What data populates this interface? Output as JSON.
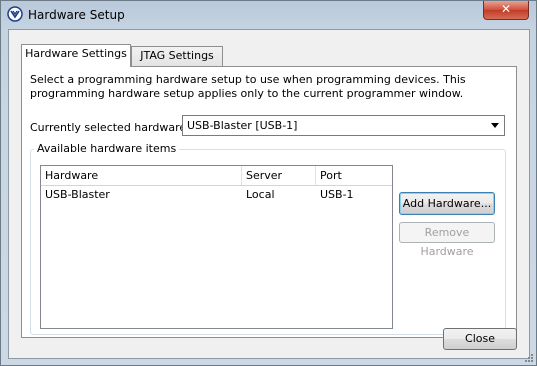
{
  "window": {
    "title": "Hardware Setup",
    "close_glyph": "✕"
  },
  "tabs": [
    {
      "label": "Hardware Settings",
      "selected": true
    },
    {
      "label": "JTAG Settings",
      "selected": false
    }
  ],
  "description": "Select a programming hardware setup to use when programming devices. This programming hardware setup applies only to the current programmer window.",
  "current_hardware": {
    "label": "Currently selected hardware:",
    "value": "USB-Blaster [USB-1]"
  },
  "available": {
    "group_label": "Available hardware items",
    "columns": [
      "Hardware",
      "Server",
      "Port"
    ],
    "rows": [
      {
        "hardware": "USB-Blaster",
        "server": "Local",
        "port": "USB-1"
      }
    ]
  },
  "buttons": {
    "add": "Add Hardware...",
    "remove": "Remove Hardware",
    "close": "Close"
  },
  "icons": {
    "app": "app-icon",
    "combo_arrow": "chevron-down-icon",
    "resize": "resize-grip-icon"
  }
}
